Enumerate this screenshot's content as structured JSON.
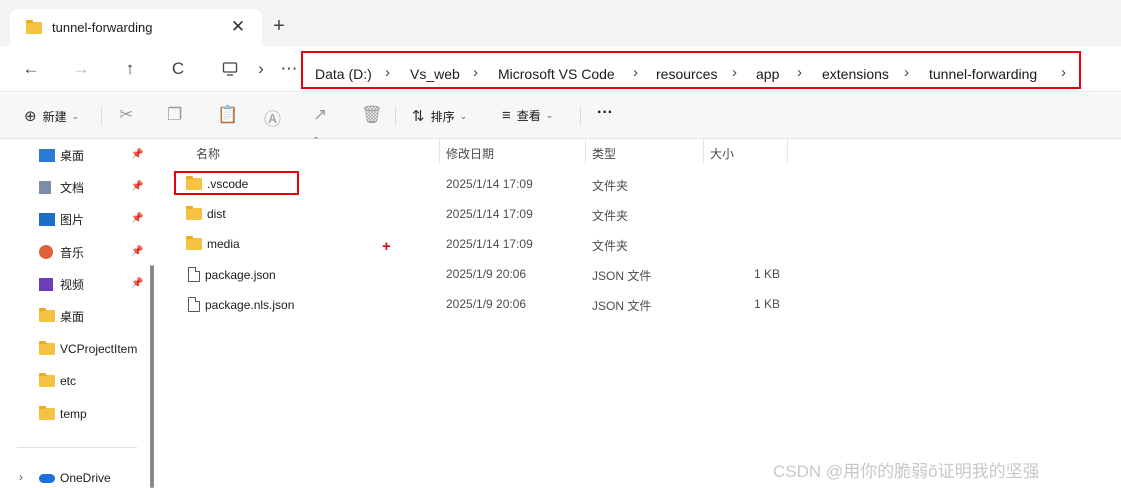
{
  "tab": {
    "title": "tunnel-forwarding",
    "close": "✕",
    "new": "+"
  },
  "nav": {
    "back": "←",
    "forward": "→",
    "up": "↑",
    "refresh": "C",
    "expand": "›",
    "more": "⋯"
  },
  "breadcrumbs": [
    "Data (D:)",
    "Vs_web",
    "Microsoft VS Code",
    "resources",
    "app",
    "extensions",
    "tunnel-forwarding"
  ],
  "breadcrumb_sep": "›",
  "toolbar": {
    "new_label": "新建",
    "sort_label": "排序",
    "view_label": "查看",
    "more": "···"
  },
  "sidebar": {
    "items": [
      {
        "label": "桌面",
        "icon": "desktop-icon",
        "pinned": true
      },
      {
        "label": "文档",
        "icon": "documents-icon",
        "pinned": true
      },
      {
        "label": "图片",
        "icon": "pictures-icon",
        "pinned": true
      },
      {
        "label": "音乐",
        "icon": "music-icon",
        "pinned": true
      },
      {
        "label": "视频",
        "icon": "videos-icon",
        "pinned": true
      },
      {
        "label": "桌面",
        "icon": "folder-icon",
        "pinned": false
      },
      {
        "label": "VCProjectItem",
        "icon": "folder-icon",
        "pinned": false
      },
      {
        "label": "etc",
        "icon": "folder-icon",
        "pinned": false
      },
      {
        "label": "temp",
        "icon": "folder-icon",
        "pinned": false
      }
    ],
    "onedrive": "OneDrive"
  },
  "columns": {
    "name": "名称",
    "modified": "修改日期",
    "type": "类型",
    "size": "大小"
  },
  "files": [
    {
      "name": ".vscode",
      "modified": "2025/1/14 17:09",
      "type": "文件夹",
      "size": "",
      "kind": "folder"
    },
    {
      "name": "dist",
      "modified": "2025/1/14 17:09",
      "type": "文件夹",
      "size": "",
      "kind": "folder"
    },
    {
      "name": "media",
      "modified": "2025/1/14 17:09",
      "type": "文件夹",
      "size": "",
      "kind": "folder"
    },
    {
      "name": "package.json",
      "modified": "2025/1/9 20:06",
      "type": "JSON 文件",
      "size": "1 KB",
      "kind": "file"
    },
    {
      "name": "package.nls.json",
      "modified": "2025/1/9 20:06",
      "type": "JSON 文件",
      "size": "1 KB",
      "kind": "file"
    }
  ],
  "annotation": {
    "plus": "+"
  },
  "watermark": "CSDN @用你的脆弱ŏ证明我的坚强",
  "colors": {
    "highlight": "#e60012",
    "folder": "#f5c342"
  }
}
